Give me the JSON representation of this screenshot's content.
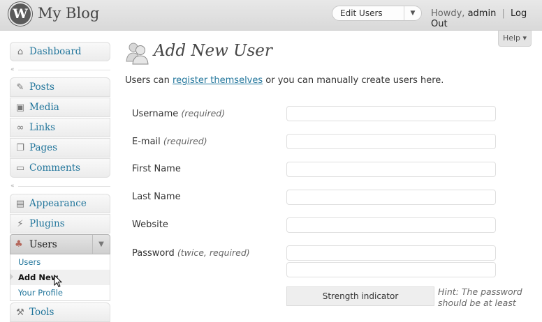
{
  "header": {
    "logo_letter": "W",
    "site_title": "My Blog",
    "favorite_action": "Edit Users",
    "howdy": "Howdy,",
    "username": "admin",
    "separator": "|",
    "logout": "Log Out"
  },
  "help_tab": "Help ▾",
  "sidebar": {
    "dashboard": "Dashboard",
    "group1": [
      "Posts",
      "Media",
      "Links",
      "Pages",
      "Comments"
    ],
    "group2": [
      "Appearance",
      "Plugins"
    ],
    "users": {
      "label": "Users",
      "submenu": [
        "Users",
        "Add New",
        "Your Profile"
      ],
      "current": "Add New"
    },
    "tools": "Tools"
  },
  "main": {
    "title": "Add New User",
    "intro_before": "Users can",
    "intro_link": "register themselves",
    "intro_after": "or you can manually create users here.",
    "fields": [
      {
        "label": "Username",
        "note": "(required)",
        "value": ""
      },
      {
        "label": "E-mail",
        "note": "(required)",
        "value": ""
      },
      {
        "label": "First Name",
        "note": "",
        "value": ""
      },
      {
        "label": "Last Name",
        "note": "",
        "value": ""
      },
      {
        "label": "Website",
        "note": "",
        "value": ""
      },
      {
        "label": "Password",
        "note": "(twice, required)",
        "value": ""
      }
    ],
    "password_confirm_value": "",
    "strength_indicator": "Strength indicator",
    "hint": "Hint: The password should be at least"
  },
  "colors": {
    "link": "#21759b",
    "header_bg": "#dfdfdf",
    "menu_current_bg": "#d5d5d5"
  }
}
